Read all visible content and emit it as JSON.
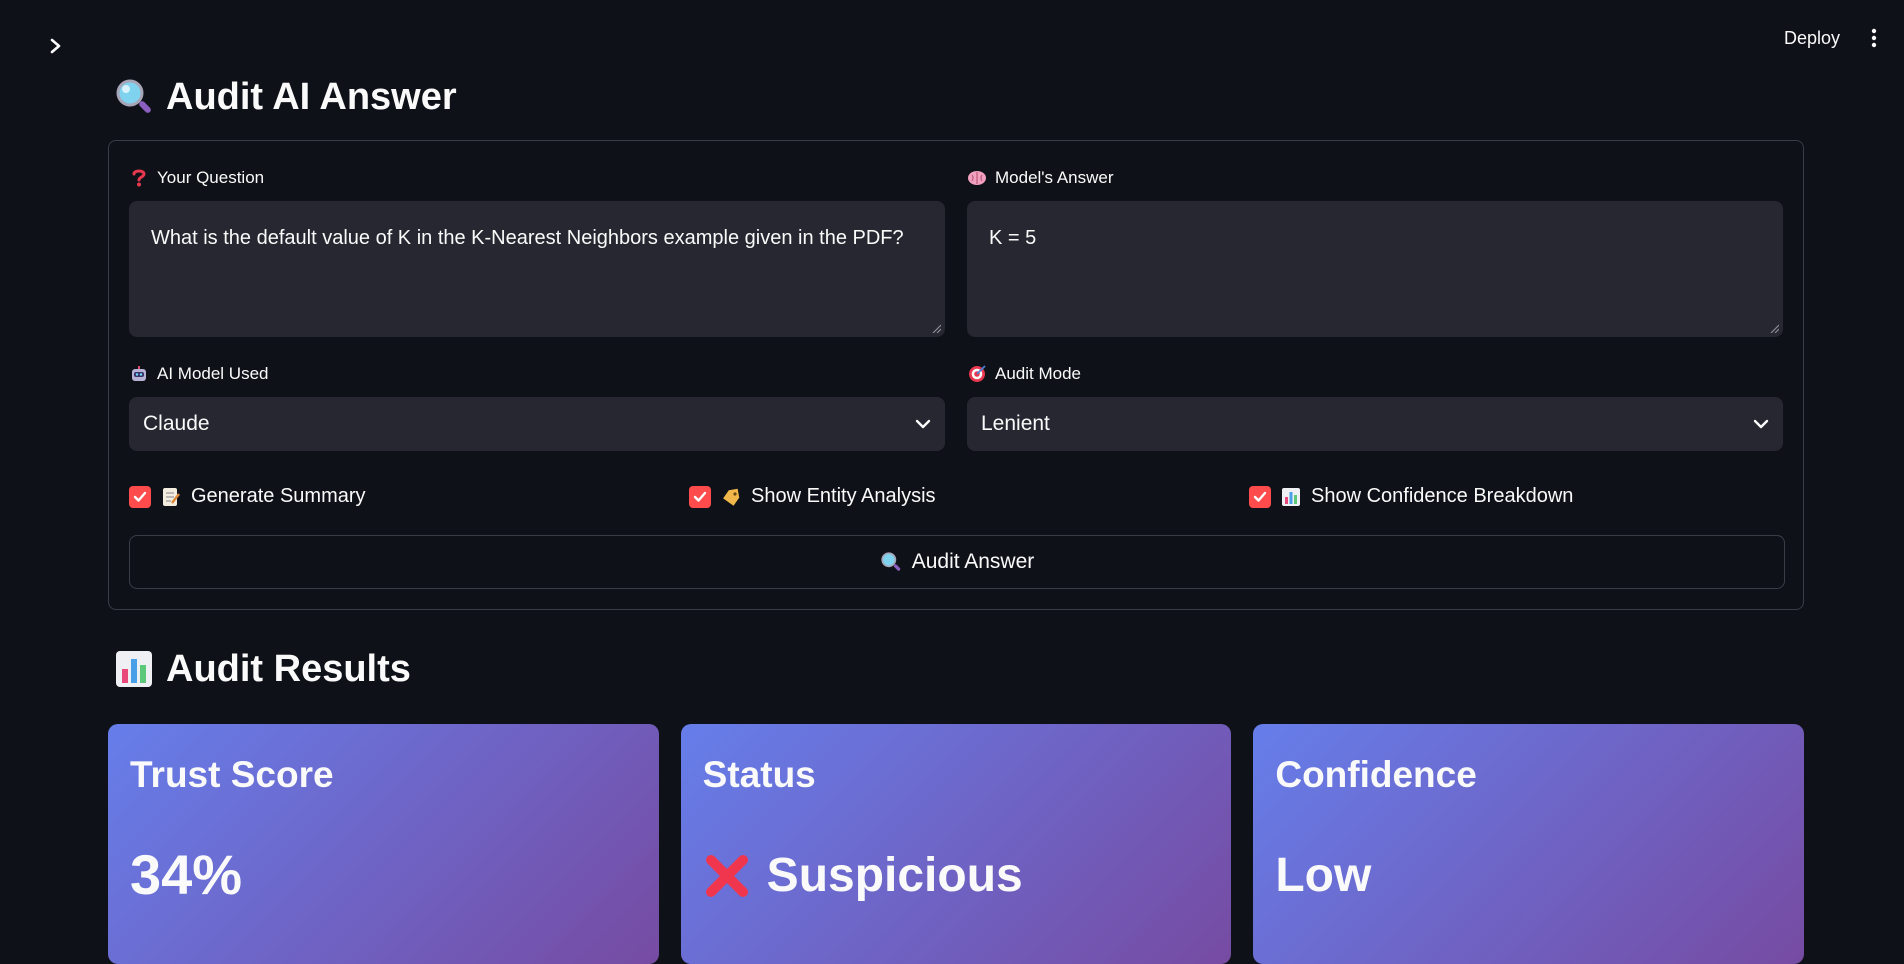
{
  "topbar": {
    "deploy_label": "Deploy"
  },
  "page": {
    "title": "Audit AI Answer"
  },
  "form": {
    "question": {
      "label": "Your Question",
      "value": "What is the default value of K in the K-Nearest Neighbors example given in the PDF?"
    },
    "answer": {
      "label": "Model's Answer",
      "value": "K = 5"
    },
    "model": {
      "label": "AI Model Used",
      "selected": "Claude"
    },
    "mode": {
      "label": "Audit Mode",
      "selected": "Lenient"
    },
    "checkboxes": [
      {
        "label": "Generate Summary",
        "checked": true,
        "icon": "memo-icon"
      },
      {
        "label": "Show Entity Analysis",
        "checked": true,
        "icon": "tag-icon"
      },
      {
        "label": "Show Confidence Breakdown",
        "checked": true,
        "icon": "bar-chart-icon"
      }
    ],
    "submit_label": "Audit Answer"
  },
  "results": {
    "title": "Audit Results",
    "cards": [
      {
        "title": "Trust Score",
        "value": "34%"
      },
      {
        "title": "Status",
        "value": "Suspicious",
        "icon": "cross-mark-icon"
      },
      {
        "title": "Confidence",
        "value": "Low"
      }
    ]
  },
  "colors": {
    "background": "#0e1117",
    "input_bg": "#262730",
    "accent": "#ff4b4b",
    "card_gradient_start": "#667eea",
    "card_gradient_end": "#764ba2"
  }
}
